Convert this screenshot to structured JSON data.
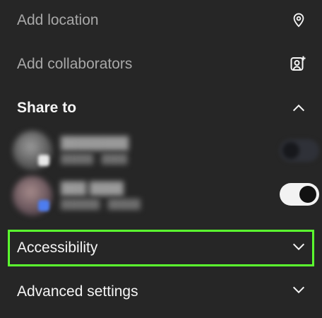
{
  "menu": {
    "add_location": "Add location",
    "add_collaborators": "Add collaborators",
    "share_to": "Share to",
    "accessibility": "Accessibility",
    "advanced_settings": "Advanced settings"
  },
  "share_accounts": [
    {
      "name": "████████",
      "sub": "█████ · ████",
      "enabled": false
    },
    {
      "name": "███ ████",
      "sub": "██████ · █████",
      "enabled": true
    }
  ],
  "icons": {
    "location": "location-pin-icon",
    "collaborators": "add-person-icon",
    "share_collapse": "chevron-up-icon",
    "accessibility_expand": "chevron-down-icon",
    "advanced_expand": "chevron-down-icon"
  },
  "colors": {
    "background": "#262626",
    "highlight": "#5bff2f"
  }
}
